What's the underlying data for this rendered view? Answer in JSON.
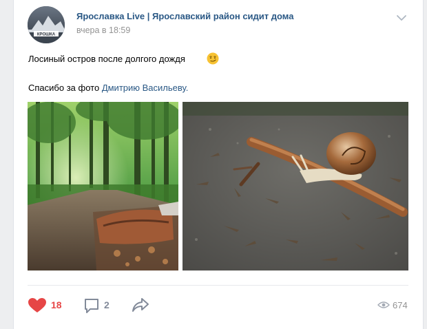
{
  "post": {
    "group_name": "Ярославка Live | Ярославский район сидит дома",
    "avatar_text": "КРОШКА",
    "time": "вчера в 18:59",
    "text_line1": "Лосиный остров после долгого дождя",
    "emoji": "smirk-emoji",
    "text_line2_prefix": "Спасибо за фото ",
    "text_line2_link": "Дмитрию Васильеву."
  },
  "photos": [
    {
      "name": "forest-path-photo",
      "description_icon": "forest"
    },
    {
      "name": "snail-photo",
      "description_icon": "snail"
    }
  ],
  "actions": {
    "likes": "18",
    "comments": "2",
    "views": "674"
  },
  "colors": {
    "link": "#2a5885",
    "like": "#e64646",
    "muted": "#828a99",
    "time": "#939393"
  },
  "icons": [
    "chevron-down-icon",
    "heart-icon",
    "comment-icon",
    "share-icon",
    "eye-icon"
  ]
}
